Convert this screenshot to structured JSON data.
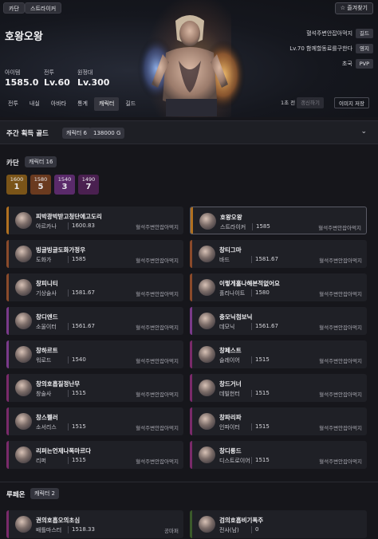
{
  "header": {
    "server_chip": "카단",
    "class_chip": "스트라이커",
    "favorite_label": "즐겨찾기",
    "character_name": "호왕오왕",
    "stats": [
      {
        "label": "아이템",
        "value": "1585.0"
      },
      {
        "label": "전투",
        "value": "Lv.60"
      },
      {
        "label": "원정대",
        "value": "Lv.300"
      }
    ],
    "guild_name": "혈석주변안잡아먹지",
    "guild_tag": "길드",
    "estate_text": "Lv.70 함께할동료를구한다",
    "estate_tag": "영지",
    "pvp_text": "초국",
    "pvp_tag": "PVP"
  },
  "tabs": [
    "전투",
    "내실",
    "아바타",
    "통계",
    "캐릭터",
    "길드"
  ],
  "active_tab": "캐릭터",
  "sync": {
    "time": "1초 전",
    "refresh_label": "갱신하기",
    "save_image_label": "이미지 저장"
  },
  "weekly": {
    "title": "주간 획득 골드",
    "count_label": "캐릭터 6",
    "gold_label": "138000 G"
  },
  "server_section": {
    "title": "카단",
    "count_label": "캐릭터 16",
    "level_groups": [
      {
        "level": "1600",
        "count": "1",
        "color": "#7a5418"
      },
      {
        "level": "1580",
        "count": "5",
        "color": "#6a3a1f"
      },
      {
        "level": "1540",
        "count": "3",
        "color": "#5a2a6a"
      },
      {
        "level": "1490",
        "count": "7",
        "color": "#4a2050"
      }
    ],
    "characters": [
      {
        "name": "피박광박받고청단에고도리",
        "class": "아르카나",
        "level": "1600.83",
        "guild": "혈석주변안잡아먹지",
        "bar": "#b07020",
        "selected": false
      },
      {
        "name": "호왕오왕",
        "class": "스트라이커",
        "level": "1585",
        "guild": "혈석주변안잡아먹지",
        "bar": "#b07020",
        "selected": true
      },
      {
        "name": "빙글빙글도화가정우",
        "class": "도화가",
        "level": "1585",
        "guild": "혈석주변안잡아먹지",
        "bar": "#8a4a2a",
        "selected": false
      },
      {
        "name": "창티그마",
        "class": "바드",
        "level": "1581.67",
        "guild": "혈석주변안잡아먹지",
        "bar": "#8a4a2a",
        "selected": false
      },
      {
        "name": "창피니티",
        "class": "기상술사",
        "level": "1581.67",
        "guild": "혈석주변안잡아먹지",
        "bar": "#8a4a2a",
        "selected": false
      },
      {
        "name": "이렇게홀나해본적없어요",
        "class": "홀리나이트",
        "level": "1580",
        "guild": "혈석주변안잡아먹지",
        "bar": "#8a4a2a",
        "selected": false
      },
      {
        "name": "창디엔드",
        "class": "소울이터",
        "level": "1561.67",
        "guild": "혈석주변안잡아먹지",
        "bar": "#7a3a8a",
        "selected": false
      },
      {
        "name": "충모닉첨보닉",
        "class": "데모닉",
        "level": "1561.67",
        "guild": "혈석주변안잡아먹지",
        "bar": "#7a3a8a",
        "selected": false
      },
      {
        "name": "창하르트",
        "class": "워로드",
        "level": "1540",
        "guild": "혈석주변안잡아먹지",
        "bar": "#7a3a8a",
        "selected": false
      },
      {
        "name": "창페스트",
        "class": "슬레이어",
        "level": "1515",
        "guild": "혈석주변안잡아먹지",
        "bar": "#7a2a6a",
        "selected": false
      },
      {
        "name": "창의호흡질정난무",
        "class": "창술사",
        "level": "1515",
        "guild": "혈석주변안잡아먹지",
        "bar": "#7a2a6a",
        "selected": false
      },
      {
        "name": "창드거너",
        "class": "데빌헌터",
        "level": "1515",
        "guild": "혈석주변안잡아먹지",
        "bar": "#7a2a6a",
        "selected": false
      },
      {
        "name": "창스펠러",
        "class": "소서리스",
        "level": "1515",
        "guild": "혈석주변안잡아먹지",
        "bar": "#7a2a6a",
        "selected": false
      },
      {
        "name": "창파리파",
        "class": "인파이터",
        "level": "1515",
        "guild": "혈석주변안잡아먹지",
        "bar": "#7a2a6a",
        "selected": false
      },
      {
        "name": "리퍼는언제나폭마르다",
        "class": "리퍼",
        "level": "1515",
        "guild": "혈석주변안잡아먹지",
        "bar": "#7a2a6a",
        "selected": false
      },
      {
        "name": "창디롱드",
        "class": "디스트로이어",
        "level": "1515",
        "guild": "혈석주변안잡아먹지",
        "bar": "#7a2a6a",
        "selected": false
      }
    ]
  },
  "rupeon_section": {
    "title": "루페온",
    "count_label": "캐릭터 2",
    "characters": [
      {
        "name": "권의호흡오의초심",
        "class": "배틀마스터",
        "level": "1518.33",
        "guild": "공마퍼",
        "bar": "#7a2a6a",
        "selected": false
      },
      {
        "name": "검의호흡비기폭주",
        "class": "전사(남)",
        "level": "0",
        "guild": "",
        "bar": "#3a5a2a",
        "selected": false
      }
    ]
  }
}
